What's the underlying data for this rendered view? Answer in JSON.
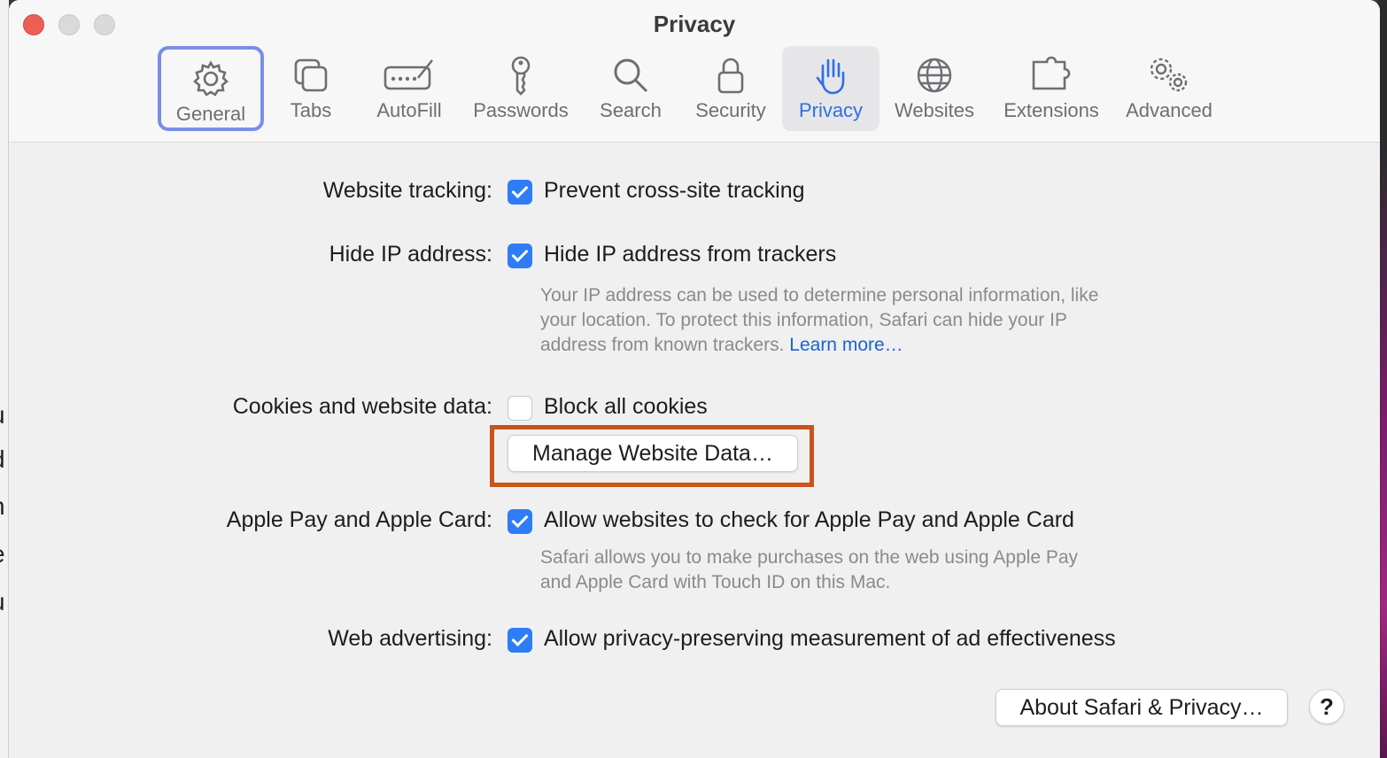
{
  "window": {
    "title": "Privacy"
  },
  "toolbar": {
    "tabs": [
      {
        "label": "General",
        "icon": "gear-icon",
        "state": "focused"
      },
      {
        "label": "Tabs",
        "icon": "tabs-icon",
        "state": "normal"
      },
      {
        "label": "AutoFill",
        "icon": "autofill-icon",
        "state": "normal"
      },
      {
        "label": "Passwords",
        "icon": "key-icon",
        "state": "normal"
      },
      {
        "label": "Search",
        "icon": "search-icon",
        "state": "normal"
      },
      {
        "label": "Security",
        "icon": "lock-icon",
        "state": "normal"
      },
      {
        "label": "Privacy",
        "icon": "hand-icon",
        "state": "selected"
      },
      {
        "label": "Websites",
        "icon": "globe-icon",
        "state": "normal"
      },
      {
        "label": "Extensions",
        "icon": "puzzle-icon",
        "state": "normal"
      },
      {
        "label": "Advanced",
        "icon": "gears-icon",
        "state": "normal"
      }
    ]
  },
  "settings": {
    "website_tracking": {
      "label": "Website tracking:",
      "option": "Prevent cross-site tracking",
      "checked": true
    },
    "hide_ip": {
      "label": "Hide IP address:",
      "option": "Hide IP address from trackers",
      "checked": true,
      "description_lines": [
        "Your IP address can be used to determine personal information, like",
        "your location. To protect this information, Safari can hide your IP",
        "address from known trackers."
      ],
      "learn_more": "Learn more…"
    },
    "cookies": {
      "label": "Cookies and website data:",
      "option": "Block all cookies",
      "checked": false,
      "manage_button": "Manage Website Data…"
    },
    "apple_pay": {
      "label": "Apple Pay and Apple Card:",
      "option": "Allow websites to check for Apple Pay and Apple Card",
      "checked": true,
      "description_lines": [
        "Safari allows you to make purchases on the web using Apple Pay",
        "and Apple Card with Touch ID on this Mac."
      ]
    },
    "web_advertising": {
      "label": "Web advertising:",
      "option": "Allow privacy-preserving measurement of ad effectiveness",
      "checked": true
    }
  },
  "footer": {
    "about_button": "About Safari & Privacy…",
    "help_button": "?"
  },
  "background_letters": [
    "u",
    "d",
    "n",
    "e",
    "u"
  ],
  "colors": {
    "accent": "#2e7cf6",
    "highlight_box": "#c8541b",
    "focus_ring": "#7a8ee6",
    "link": "#1a63d6"
  }
}
